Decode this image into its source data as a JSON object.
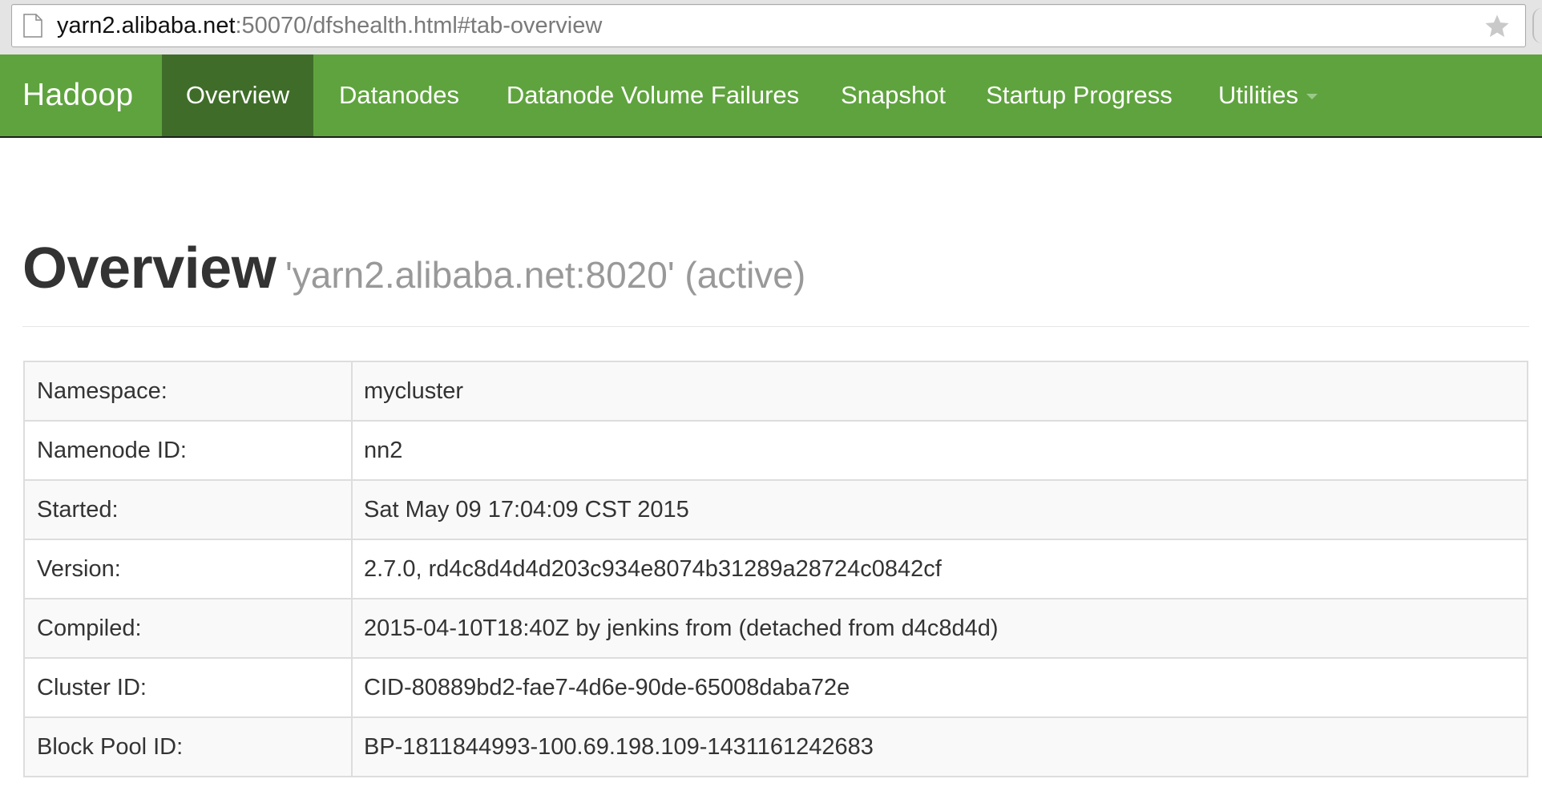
{
  "browser": {
    "url_host": "yarn2.alibaba.net",
    "url_rest": ":50070/dfshealth.html#tab-overview",
    "page_icon": "document-icon",
    "bookmark_icon": "star-icon"
  },
  "navbar": {
    "brand": "Hadoop",
    "items": [
      {
        "label": "Overview",
        "active": true
      },
      {
        "label": "Datanodes"
      },
      {
        "label": "Datanode Volume Failures"
      },
      {
        "label": "Snapshot"
      },
      {
        "label": "Startup Progress"
      },
      {
        "label": "Utilities",
        "dropdown": true
      }
    ]
  },
  "header": {
    "title": "Overview",
    "subtitle": "'yarn2.alibaba.net:8020' (active)"
  },
  "info": [
    {
      "label": "Namespace:",
      "value": "mycluster"
    },
    {
      "label": "Namenode ID:",
      "value": "nn2"
    },
    {
      "label": "Started:",
      "value": "Sat May 09 17:04:09 CST 2015"
    },
    {
      "label": "Version:",
      "value": "2.7.0, rd4c8d4d4d203c934e8074b31289a28724c0842cf"
    },
    {
      "label": "Compiled:",
      "value": "2015-04-10T18:40Z by jenkins from (detached from d4c8d4d)"
    },
    {
      "label": "Cluster ID:",
      "value": "CID-80889bd2-fae7-4d6e-90de-65008daba72e"
    },
    {
      "label": "Block Pool ID:",
      "value": "BP-1811844993-100.69.198.109-1431161242683"
    }
  ],
  "colors": {
    "navbar": "#5fa33e",
    "navbar_active": "#3f6d29"
  }
}
